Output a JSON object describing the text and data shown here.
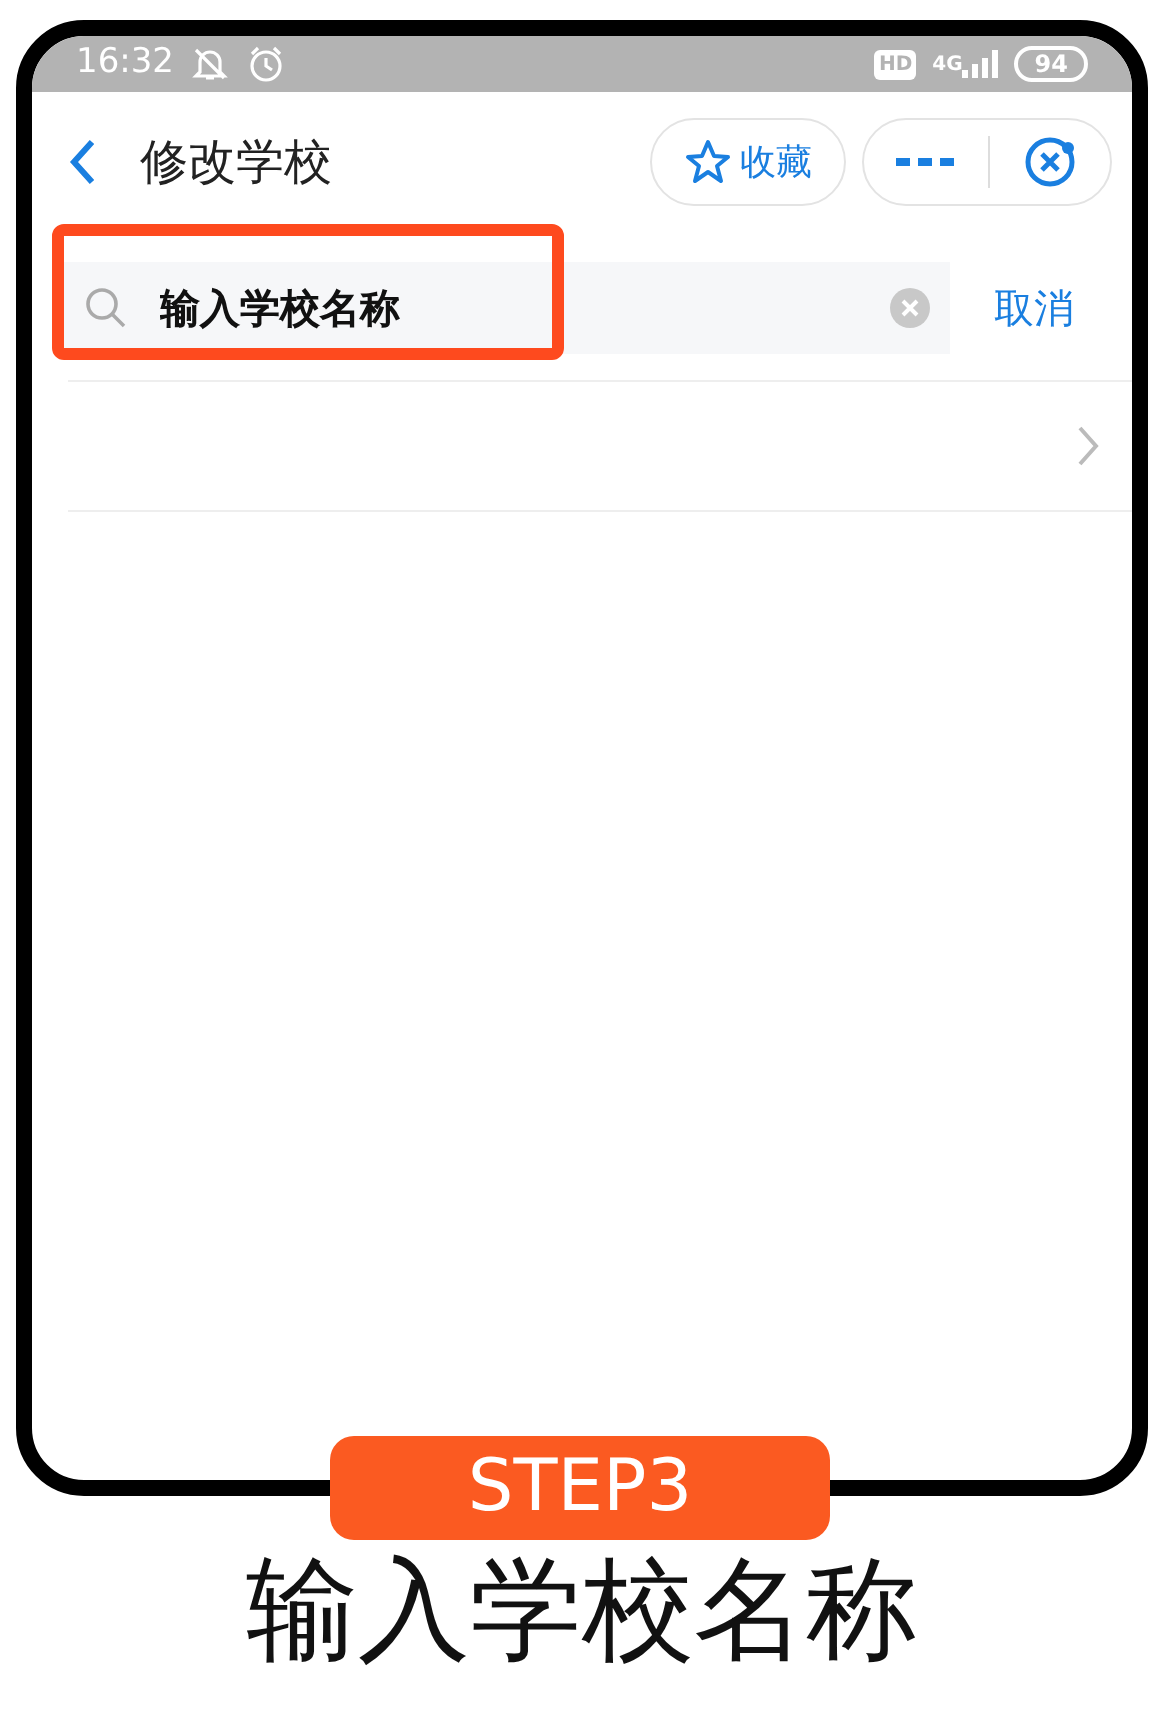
{
  "status_bar": {
    "time": "16:32",
    "hd": "HD",
    "network": "4G",
    "battery": "94"
  },
  "header": {
    "title": "修改学校",
    "favorite_button": "收藏"
  },
  "search": {
    "value": "输入学校名称",
    "highlighted": true,
    "cancel": "取消"
  },
  "step_badge": "STEP3",
  "caption": "输入学校名称"
}
